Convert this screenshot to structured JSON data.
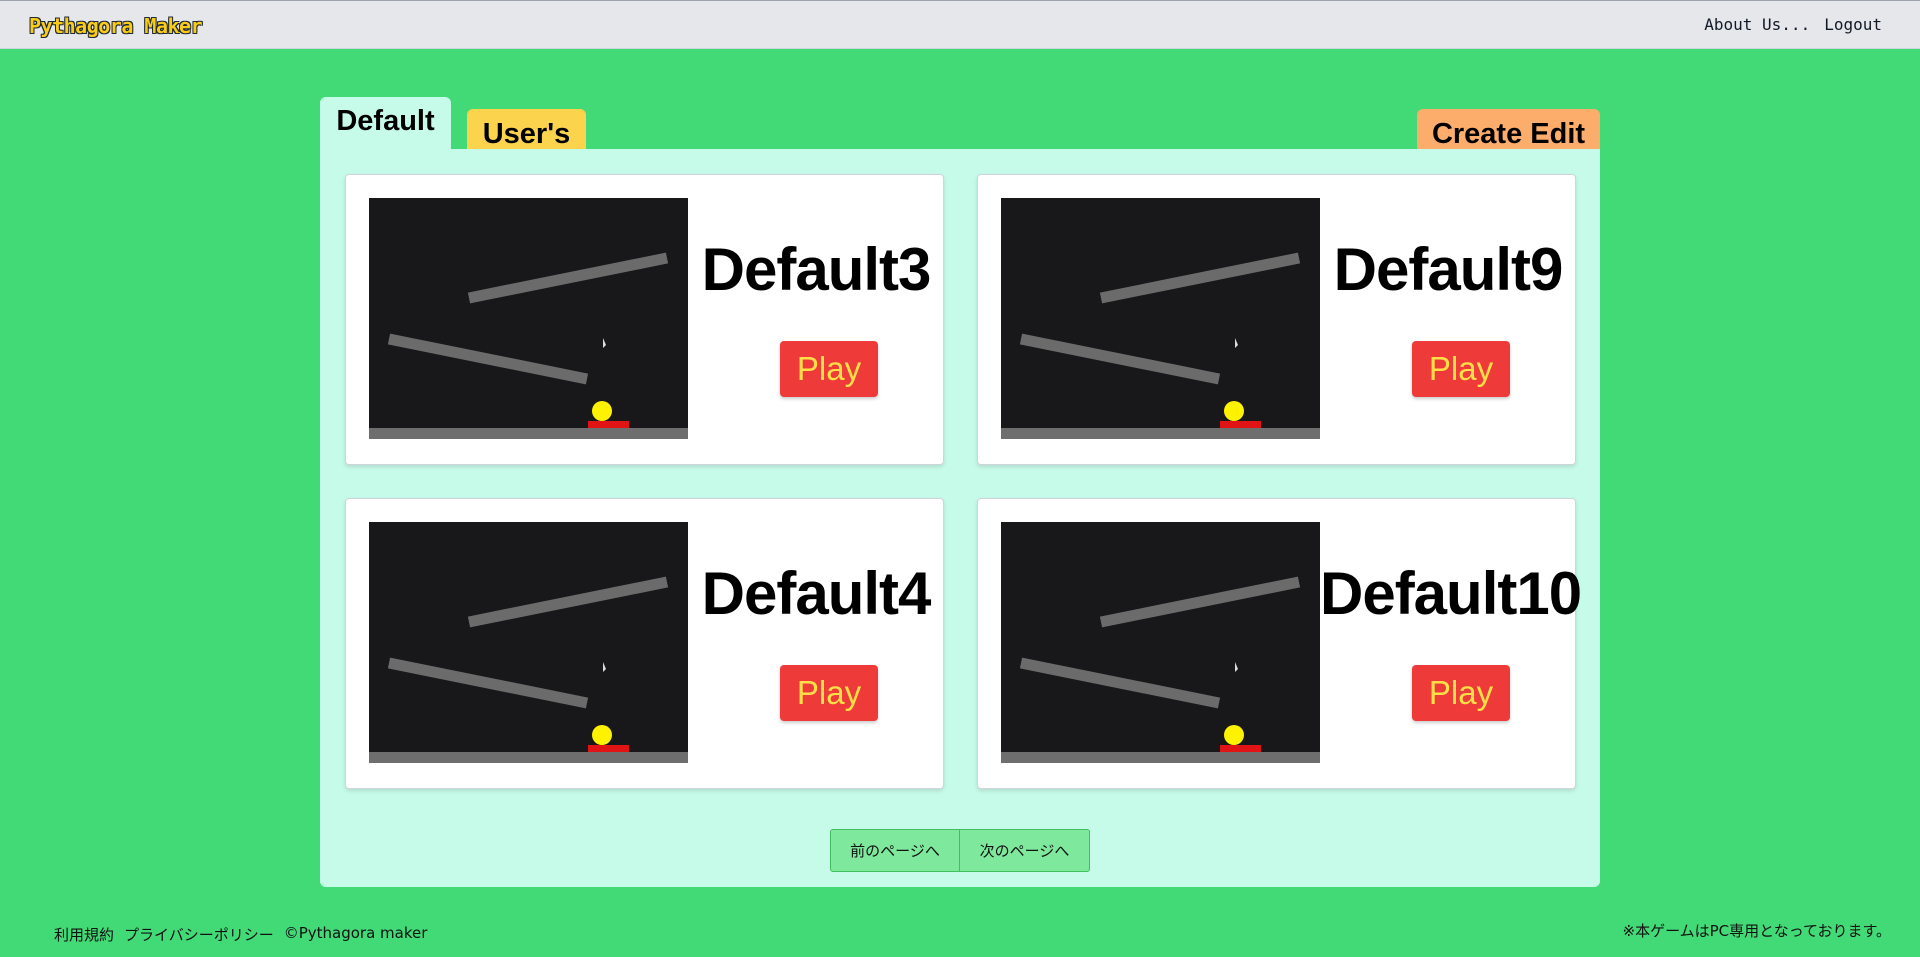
{
  "header": {
    "logo": "Pythagora Maker",
    "nav": {
      "about": "About Us...",
      "logout": "Logout"
    }
  },
  "tabs": {
    "default": "Default",
    "users": "User's",
    "create_edit": "Create Edit"
  },
  "colors": {
    "background": "#42d977",
    "panel": "#c7fbe9",
    "play_button": "#ef3a3a",
    "play_text": "#fde047",
    "users_tab": "#fcd34d",
    "create_tab": "#fdad6b"
  },
  "cards": [
    {
      "title": "Default3",
      "play_label": "Play"
    },
    {
      "title": "Default9",
      "play_label": "Play"
    },
    {
      "title": "Default4",
      "play_label": "Play"
    },
    {
      "title": "Default10",
      "play_label": "Play"
    }
  ],
  "pagination": {
    "prev_label": "前のページへ",
    "next_label": "次のページへ"
  },
  "footer": {
    "terms": "利用規約",
    "privacy": "プライバシーポリシー",
    "copyright": "©Pythagora maker",
    "notice": "※本ゲームはPC専用となっております。"
  }
}
